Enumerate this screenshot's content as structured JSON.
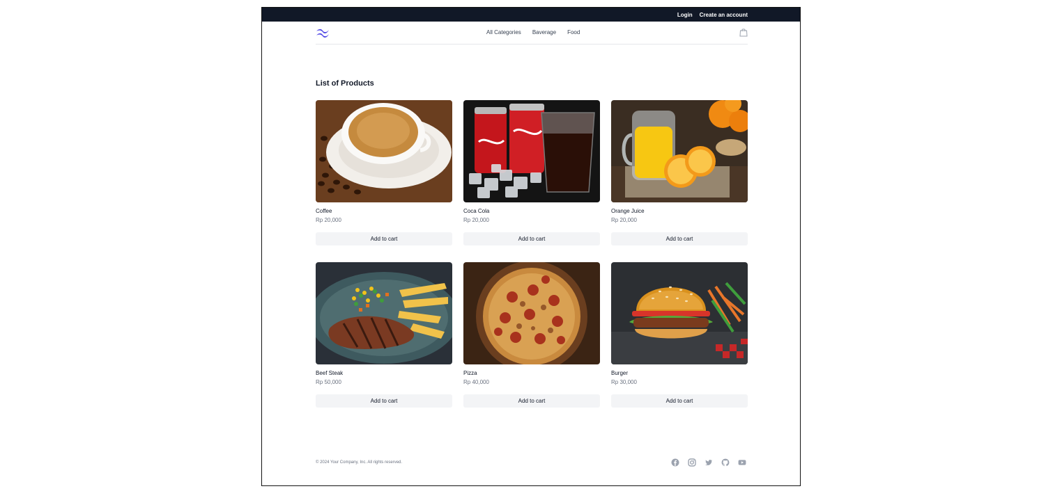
{
  "topbar": {
    "login": "Login",
    "create_account": "Create an account"
  },
  "nav": {
    "links": [
      "All Categories",
      "Baverage",
      "Food"
    ]
  },
  "main": {
    "heading": "List of Products"
  },
  "products": [
    {
      "name": "Coffee",
      "price": "Rp 20,000",
      "button": "Add to cart"
    },
    {
      "name": "Coca Cola",
      "price": "Rp 20,000",
      "button": "Add to cart"
    },
    {
      "name": "Orange Juice",
      "price": "Rp 20,000",
      "button": "Add to cart"
    },
    {
      "name": "Beef Steak",
      "price": "Rp 50,000",
      "button": "Add to cart"
    },
    {
      "name": "Pizza",
      "price": "Rp 40,000",
      "button": "Add to cart"
    },
    {
      "name": "Burger",
      "price": "Rp 30,000",
      "button": "Add to cart"
    }
  ],
  "footer": {
    "copyright": "© 2024 Your Company, Inc. All rights reserved.",
    "socials": [
      "facebook-icon",
      "instagram-icon",
      "twitter-icon",
      "github-icon",
      "youtube-icon"
    ]
  },
  "colors": {
    "topbar_bg": "#111827",
    "brand": "#4f46e5",
    "button_bg": "#f3f4f6"
  }
}
